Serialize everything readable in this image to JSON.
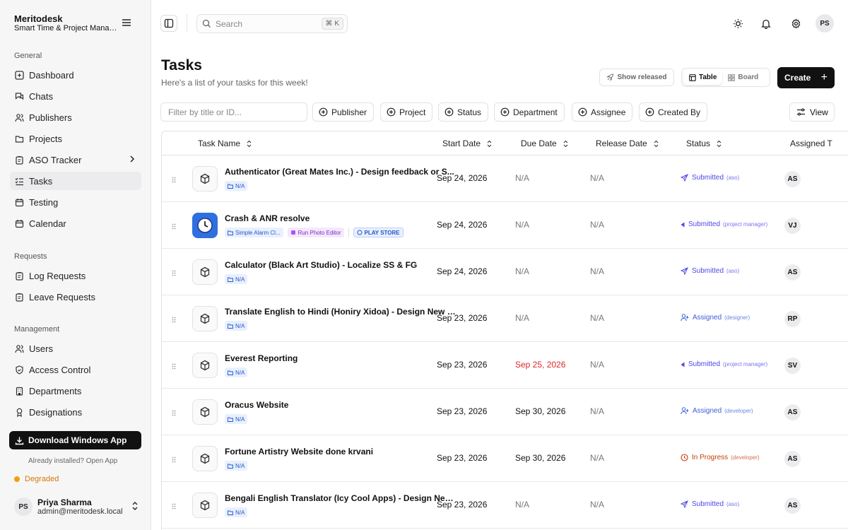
{
  "sidebar": {
    "brand_name": "Meritodesk",
    "brand_sub": "Smart Time & Project Management",
    "sections": {
      "general": "General",
      "requests": "Requests",
      "management": "Management"
    },
    "items": [
      {
        "label": "Dashboard",
        "icon": "dashboard-icon"
      },
      {
        "label": "Chats",
        "icon": "chat-icon"
      },
      {
        "label": "Publishers",
        "icon": "users-icon"
      },
      {
        "label": "Projects",
        "icon": "folder-icon"
      },
      {
        "label": "ASO Tracker",
        "icon": "clipboard-icon"
      },
      {
        "label": "Tasks",
        "icon": "list-check-icon"
      },
      {
        "label": "Testing",
        "icon": "calendar-icon"
      },
      {
        "label": "Calendar",
        "icon": "calendar-icon"
      },
      {
        "label": "Log Requests",
        "icon": "clipboard-icon"
      },
      {
        "label": "Leave Requests",
        "icon": "clipboard-icon"
      },
      {
        "label": "Users",
        "icon": "users-icon"
      },
      {
        "label": "Access Control",
        "icon": "shield-icon"
      },
      {
        "label": "Departments",
        "icon": "building-icon"
      },
      {
        "label": "Designations",
        "icon": "badge-icon"
      }
    ],
    "download_label": "Download Windows App",
    "installed_text": "Already installed? Open App",
    "status_text": "Degraded",
    "user": {
      "initials": "PS",
      "name": "Priya Sharma",
      "email": "admin@meritodesk.local"
    }
  },
  "topbar": {
    "search_placeholder": "Search",
    "shortcut": "⌘ K",
    "avatar_initials": "PS"
  },
  "page": {
    "title": "Tasks",
    "subtitle": "Here's a list of your tasks for this week!",
    "show_released": "Show released",
    "view_table": "Table",
    "view_board": "Board",
    "create_label": "Create"
  },
  "filters": {
    "placeholder": "Filter by title or ID...",
    "chips": [
      "Publisher",
      "Project",
      "Status",
      "Department",
      "Assignee",
      "Created By"
    ],
    "view_label": "View"
  },
  "table": {
    "columns": [
      "Task Name",
      "Start Date",
      "Due Date",
      "Release Date",
      "Status",
      "Assigned T"
    ],
    "rows": [
      {
        "title": "Authenticator (Great Mates Inc.) - Design feedback or S...",
        "tags": [
          "N/A"
        ],
        "start": "Sep 24, 2026",
        "due": "N/A",
        "release": "N/A",
        "status": "Submitted",
        "role": "(aso)",
        "assignee": "AS"
      },
      {
        "title": "Crash & ANR resolve",
        "tags": [
          "Simple Alarm Cl...",
          "Run Photo Editor",
          "PLAY STORE"
        ],
        "start": "Sep 24, 2026",
        "due": "N/A",
        "release": "N/A",
        "status": "Submitted",
        "role": "(project manager)",
        "assignee": "VJ"
      },
      {
        "title": "Calculator (Black Art Studio) - Localize SS & FG",
        "tags": [
          "N/A"
        ],
        "start": "Sep 24, 2026",
        "due": "N/A",
        "release": "N/A",
        "status": "Submitted",
        "role": "(aso)",
        "assignee": "AS"
      },
      {
        "title": "Translate English to Hindi (Honiry Xidoa) - Design New S...",
        "tags": [
          "N/A"
        ],
        "start": "Sep 23, 2026",
        "due": "N/A",
        "release": "N/A",
        "status": "Assigned",
        "role": "(designer)",
        "assignee": "RP"
      },
      {
        "title": "Everest Reporting",
        "tags": [
          "N/A"
        ],
        "start": "Sep 23, 2026",
        "due": "Sep 25, 2026",
        "release": "N/A",
        "status": "Submitted",
        "role": "(project manager)",
        "assignee": "SV"
      },
      {
        "title": "Oracus Website",
        "tags": [
          "N/A"
        ],
        "start": "Sep 23, 2026",
        "due": "Sep 30, 2026",
        "release": "N/A",
        "status": "Assigned",
        "role": "(developer)",
        "assignee": "AS"
      },
      {
        "title": "Fortune Artistry Website done krvani",
        "tags": [
          "N/A"
        ],
        "start": "Sep 23, 2026",
        "due": "Sep 30, 2026",
        "release": "N/A",
        "status": "In Progress",
        "role": "(developer)",
        "assignee": "AS"
      },
      {
        "title": "Bengali English Translator (Icy Cool Apps) - Design New ...",
        "tags": [
          "N/A"
        ],
        "start": "Sep 23, 2026",
        "due": "N/A",
        "release": "N/A",
        "status": "Submitted",
        "role": "(aso)",
        "assignee": "AS"
      }
    ]
  },
  "colors": {
    "primary": "#111111",
    "submitted": "#4f46e5",
    "assigned": "#3b5bdb",
    "in_progress": "#c2410c",
    "overdue": "#dc2626",
    "degraded": "#f59e0b"
  }
}
